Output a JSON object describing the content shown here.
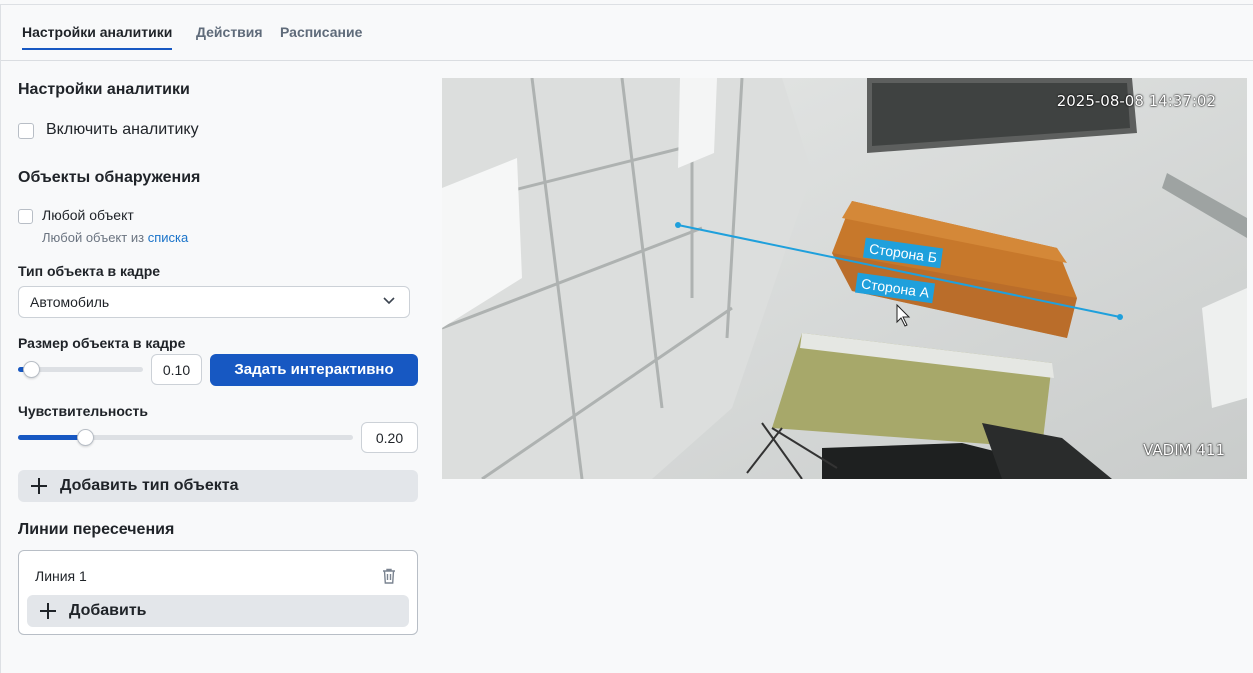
{
  "tabs": [
    {
      "label": "Настройки аналитики",
      "active": true
    },
    {
      "label": "Действия",
      "active": false
    },
    {
      "label": "Расписание",
      "active": false
    }
  ],
  "analytics": {
    "heading": "Настройки аналитики",
    "enable_label": "Включить аналитику",
    "enable_checked": false
  },
  "detection": {
    "heading": "Объекты обнаружения",
    "any_object_label": "Любой объект",
    "any_object_checked": false,
    "any_object_hint_prefix": "Любой объект из",
    "any_object_hint_link": "списка",
    "object_type_label": "Тип объекта в кадре",
    "object_type_value": "Автомобиль",
    "size_label": "Размер объекта в кадре",
    "size_value": "0.10",
    "size_fraction": 0.1,
    "set_interactive_label": "Задать интерактивно",
    "sensitivity_label": "Чувствительность",
    "sensitivity_value": "0.20",
    "sensitivity_fraction": 0.2,
    "add_object_type_label": "Добавить тип объекта"
  },
  "crossing_lines": {
    "heading": "Линии пересечения",
    "items": [
      {
        "name": "Линия 1"
      }
    ],
    "add_label": "Добавить"
  },
  "video": {
    "timestamp": "2025-08-08 14:37:02",
    "camera_name": "VADIM 411",
    "side_b_label": "Сторона Б",
    "side_a_label": "Сторона А",
    "line_color": "#1fa0dc"
  },
  "colors": {
    "accent": "#1758c2",
    "link": "#1a73c9"
  }
}
